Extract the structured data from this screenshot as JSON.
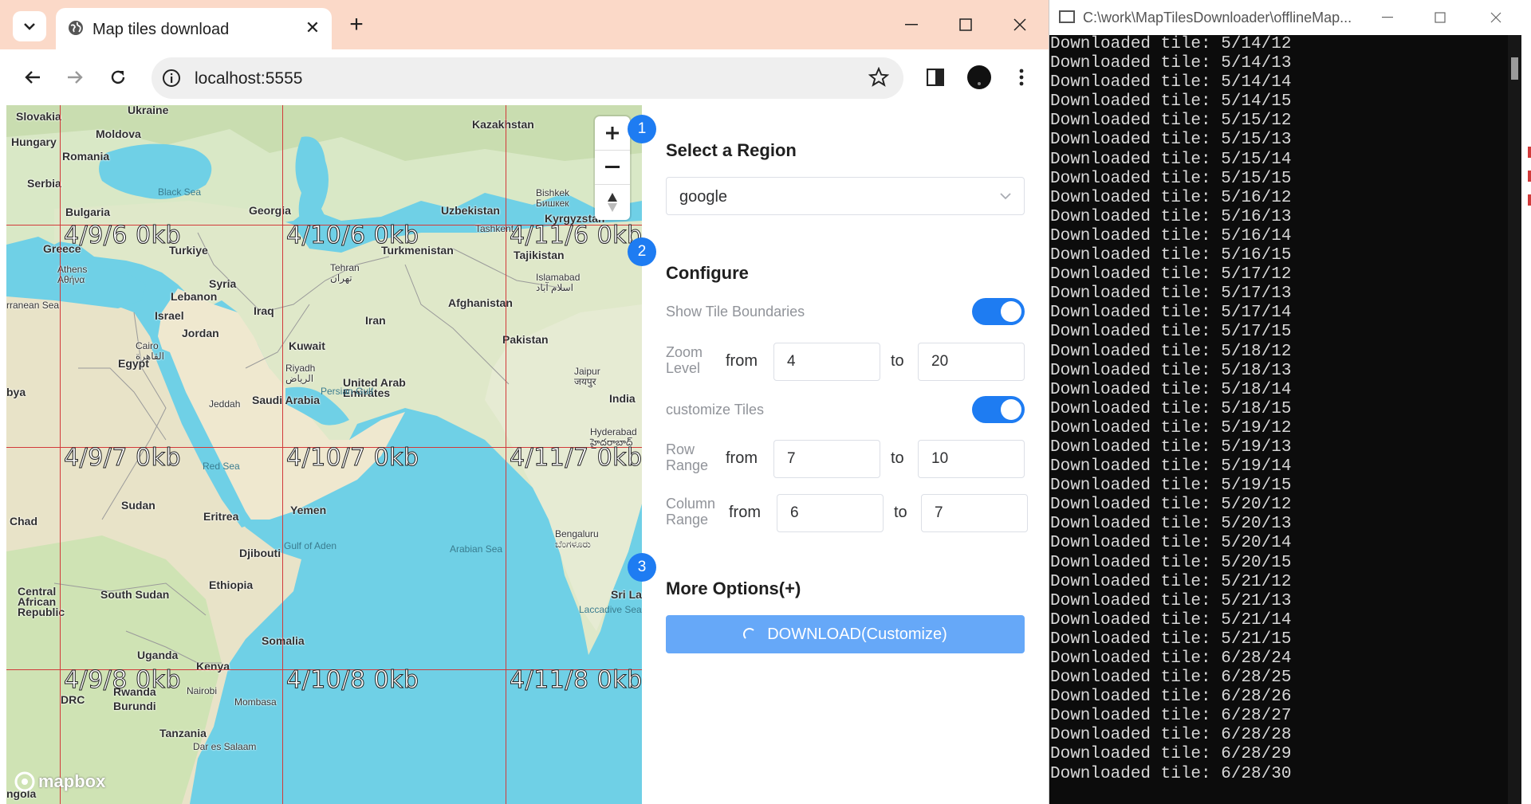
{
  "browser": {
    "tab_title": "Map tiles download",
    "url": "localhost:5555",
    "colors": {
      "tabstrip": "#fbd9c8",
      "accent": "#1e7cf2"
    }
  },
  "map": {
    "places": [
      {
        "label": "Ukraine"
      },
      {
        "label": "Slovakia"
      },
      {
        "label": "Moldova"
      },
      {
        "label": "Hungary"
      },
      {
        "label": "Romania"
      },
      {
        "label": "Serbia"
      },
      {
        "label": "Bulgaria"
      },
      {
        "label": "Georgia"
      },
      {
        "label": "Kazakhstan"
      },
      {
        "label": "Uzbekistan"
      },
      {
        "label": "Bishkek\nБишкек"
      },
      {
        "label": "Kyrgyzstan"
      },
      {
        "label": "Tashkent"
      },
      {
        "label": "Turkiye"
      },
      {
        "label": "Greece"
      },
      {
        "label": "Turkmenistan"
      },
      {
        "label": "Tajikistan"
      },
      {
        "label": "Athens\nΑθήνα"
      },
      {
        "label": "Tehran\nتهران"
      },
      {
        "label": "Syria"
      },
      {
        "label": "Islamabad\nاسلام آباد"
      },
      {
        "label": "Lebanon"
      },
      {
        "label": "Afghanistan"
      },
      {
        "label": "Iraq"
      },
      {
        "label": "Israel"
      },
      {
        "label": "Jordan"
      },
      {
        "label": "Iran"
      },
      {
        "label": "Cairo\nالقاهرة"
      },
      {
        "label": "Kuwait"
      },
      {
        "label": "Pakistan"
      },
      {
        "label": "Egypt"
      },
      {
        "label": "Riyadh\nالرياض"
      },
      {
        "label": "Jaipur\nजयपुर"
      },
      {
        "label": "United Arab\nEmirates"
      },
      {
        "label": "Jeddah"
      },
      {
        "label": "Saudi Arabia"
      },
      {
        "label": "India"
      },
      {
        "label": "Sudan"
      },
      {
        "label": "Eritrea"
      },
      {
        "label": "Yemen"
      },
      {
        "label": "Hyderabad\nహైదరాబాద్"
      },
      {
        "label": "Chad"
      },
      {
        "label": "Djibouti"
      },
      {
        "label": "Bengaluru\nಬೆಂಗಳೂರು"
      },
      {
        "label": "Ethiopia"
      },
      {
        "label": "South Sudan"
      },
      {
        "label": "Central\nAfrican\nRepublic"
      },
      {
        "label": "Sri La"
      },
      {
        "label": "Somalia"
      },
      {
        "label": "Uganda"
      },
      {
        "label": "Kenya"
      },
      {
        "label": "Nairobi"
      },
      {
        "label": "Rwanda"
      },
      {
        "label": "DRC"
      },
      {
        "label": "Burundi"
      },
      {
        "label": "Mombasa"
      },
      {
        "label": "Tanzania"
      },
      {
        "label": "Dar es Salaam"
      },
      {
        "label": "bya"
      },
      {
        "label": "rranean Sea"
      },
      {
        "label": "ngola"
      }
    ],
    "seas": [
      "Black Sea",
      "Persian Gulf",
      "Red Sea",
      "Gulf of Aden",
      "Arabian Sea",
      "Laccadive Sea"
    ],
    "tiles": [
      "4/9/6 0kb",
      "4/10/6 0kb",
      "4/11/6 0kb",
      "4/9/7 0kb",
      "4/10/7 0kb",
      "4/11/7 0kb",
      "4/9/8 0kb",
      "4/10/8 0kb",
      "4/11/8 0kb"
    ],
    "attribution": "mapbox"
  },
  "panel": {
    "step1": "1",
    "step2": "2",
    "step3": "3",
    "region_title": "Select a Region",
    "region_value": "google",
    "configure_title": "Configure",
    "show_boundaries_label": "Show Tile Boundaries",
    "show_boundaries_on": true,
    "zoom_label_1": "Zoom",
    "zoom_label_2": "Level",
    "zoom_from": "4",
    "zoom_to": "20",
    "customize_label": "customize Tiles",
    "customize_on": true,
    "row_label_1": "Row",
    "row_label_2": "Range",
    "row_from": "7",
    "row_to": "10",
    "col_label_1": "Column",
    "col_label_2": "Range",
    "col_from": "6",
    "col_to": "7",
    "from_text": "from",
    "to_text": "to",
    "more_options": "More Options(+)",
    "download_label": "DOWNLOAD(Customize)"
  },
  "console": {
    "title": "C:\\work\\MapTilesDownloader\\offlineMap...",
    "lines": [
      "Downloaded tile: 5/14/12",
      "Downloaded tile: 5/14/13",
      "Downloaded tile: 5/14/14",
      "Downloaded tile: 5/14/15",
      "Downloaded tile: 5/15/12",
      "Downloaded tile: 5/15/13",
      "Downloaded tile: 5/15/14",
      "Downloaded tile: 5/15/15",
      "Downloaded tile: 5/16/12",
      "Downloaded tile: 5/16/13",
      "Downloaded tile: 5/16/14",
      "Downloaded tile: 5/16/15",
      "Downloaded tile: 5/17/12",
      "Downloaded tile: 5/17/13",
      "Downloaded tile: 5/17/14",
      "Downloaded tile: 5/17/15",
      "Downloaded tile: 5/18/12",
      "Downloaded tile: 5/18/13",
      "Downloaded tile: 5/18/14",
      "Downloaded tile: 5/18/15",
      "Downloaded tile: 5/19/12",
      "Downloaded tile: 5/19/13",
      "Downloaded tile: 5/19/14",
      "Downloaded tile: 5/19/15",
      "Downloaded tile: 5/20/12",
      "Downloaded tile: 5/20/13",
      "Downloaded tile: 5/20/14",
      "Downloaded tile: 5/20/15",
      "Downloaded tile: 5/21/12",
      "Downloaded tile: 5/21/13",
      "Downloaded tile: 5/21/14",
      "Downloaded tile: 5/21/15",
      "Downloaded tile: 6/28/24",
      "Downloaded tile: 6/28/25",
      "Downloaded tile: 6/28/26",
      "Downloaded tile: 6/28/27",
      "Downloaded tile: 6/28/28",
      "Downloaded tile: 6/28/29",
      "Downloaded tile: 6/28/30"
    ]
  }
}
